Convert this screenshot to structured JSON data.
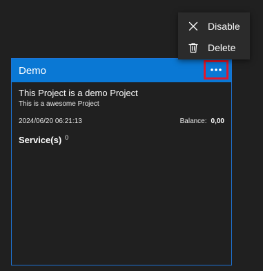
{
  "card": {
    "title": "Demo",
    "more_icon": "more-horizontal-icon",
    "description": "This Project is a demo Project",
    "subtitle": "This is a awesome Project",
    "timestamp": "2024/06/20 06:21:13",
    "balance_label": "Balance:",
    "balance_value": "0,00",
    "services_label": "Service(s)",
    "services_count": "0"
  },
  "menu": {
    "items": [
      {
        "label": "Disable",
        "icon": "close-icon"
      },
      {
        "label": "Delete",
        "icon": "trash-icon"
      }
    ]
  },
  "colors": {
    "background": "#202020",
    "header": "#0a78d4",
    "card_border": "#1e74d6",
    "highlight": "#e0182c",
    "menu_background": "#2b2b2b"
  }
}
